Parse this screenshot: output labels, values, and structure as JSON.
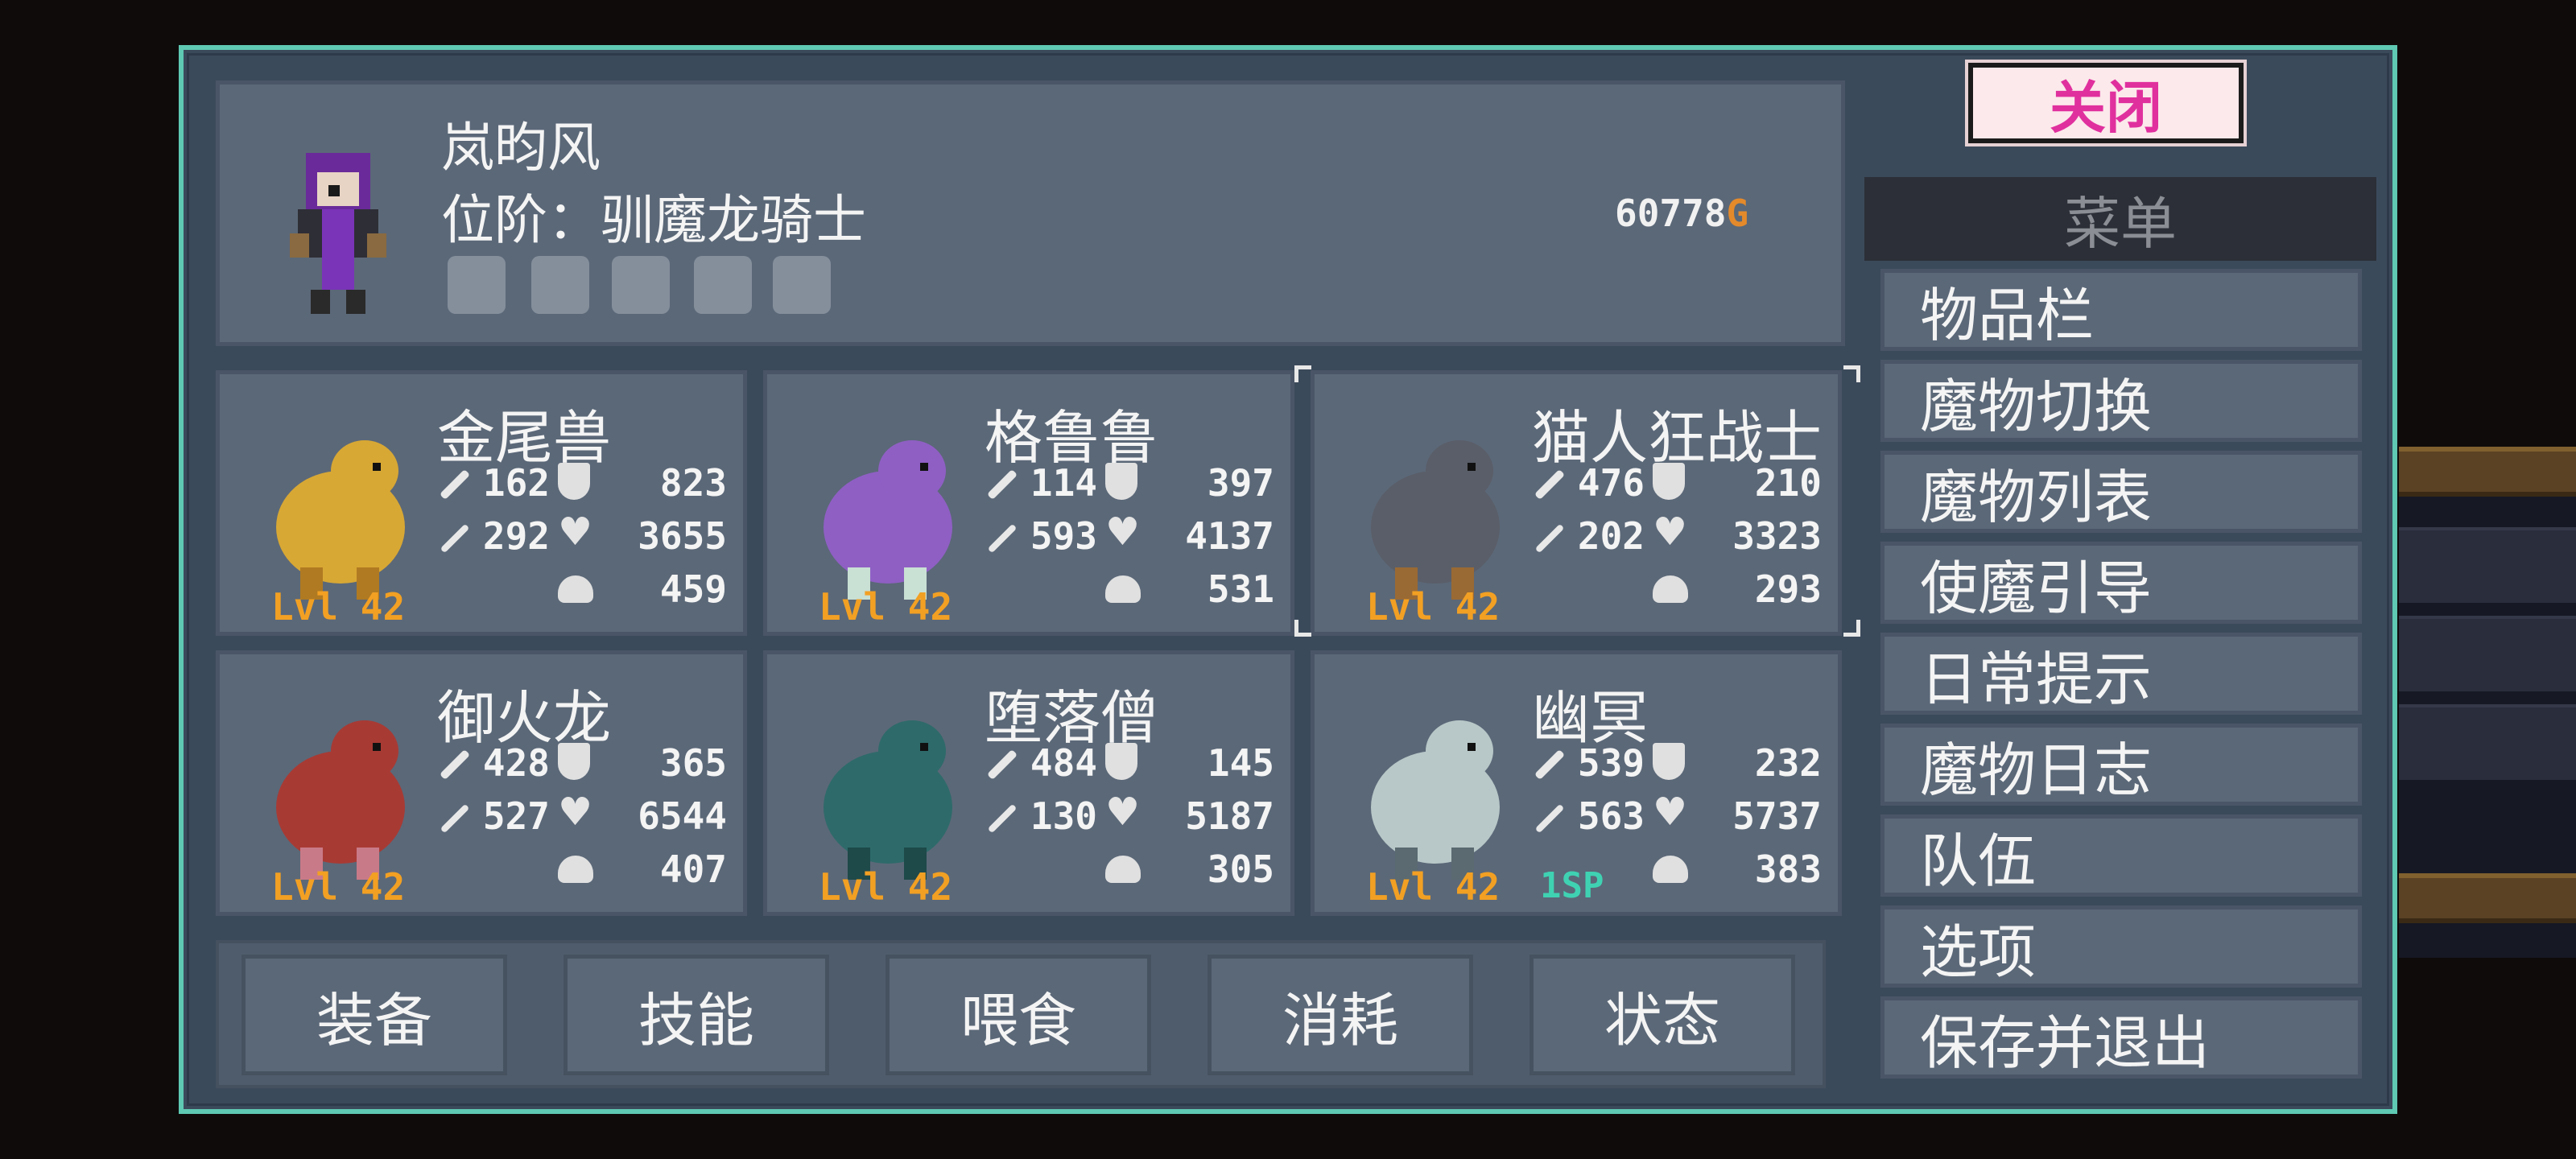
{
  "player": {
    "name": "岚昀风",
    "rank": "位阶：驯魔龙骑士",
    "gold_amount": "60778",
    "gold_unit": "G",
    "equipment_slots": [
      "weapon-slot-icon",
      "armor-slot-icon",
      "helmet-slot-icon",
      "accessory-slot-icon",
      "ring-slot-icon"
    ]
  },
  "monsters": [
    {
      "name": "金尾兽",
      "atk": "162",
      "def": "823",
      "matk": "292",
      "hp": "3655",
      "weight": "459",
      "level": "Lvl 42",
      "sp": ""
    },
    {
      "name": "格鲁鲁",
      "atk": "114",
      "def": "397",
      "matk": "593",
      "hp": "4137",
      "weight": "531",
      "level": "Lvl 42",
      "sp": ""
    },
    {
      "name": "猫人狂战士",
      "atk": "476",
      "def": "210",
      "matk": "202",
      "hp": "3323",
      "weight": "293",
      "level": "Lvl 42",
      "sp": ""
    },
    {
      "name": "御火龙",
      "atk": "428",
      "def": "365",
      "matk": "527",
      "hp": "6544",
      "weight": "407",
      "level": "Lvl 42",
      "sp": ""
    },
    {
      "name": "堕落僧",
      "atk": "484",
      "def": "145",
      "matk": "130",
      "hp": "5187",
      "weight": "305",
      "level": "Lvl 42",
      "sp": ""
    },
    {
      "name": "幽冥",
      "atk": "539",
      "def": "232",
      "matk": "563",
      "hp": "5737",
      "weight": "383",
      "level": "Lvl 42",
      "sp": "1SP"
    }
  ],
  "actions": [
    "装备",
    "技能",
    "喂食",
    "消耗",
    "状态"
  ],
  "menu": {
    "close_label": "关闭",
    "title": "菜单",
    "items": [
      "物品栏",
      "魔物切换",
      "魔物列表",
      "使魔引导",
      "日常提示",
      "魔物日志",
      "队伍",
      "选项",
      "保存并退出"
    ]
  },
  "colors": {
    "frame": "#5fc9b3",
    "panel": "#5b6878",
    "level": "#f2a023",
    "sp": "#3fd2b2",
    "gold": "#e58a2a",
    "close_text": "#e0309e"
  }
}
